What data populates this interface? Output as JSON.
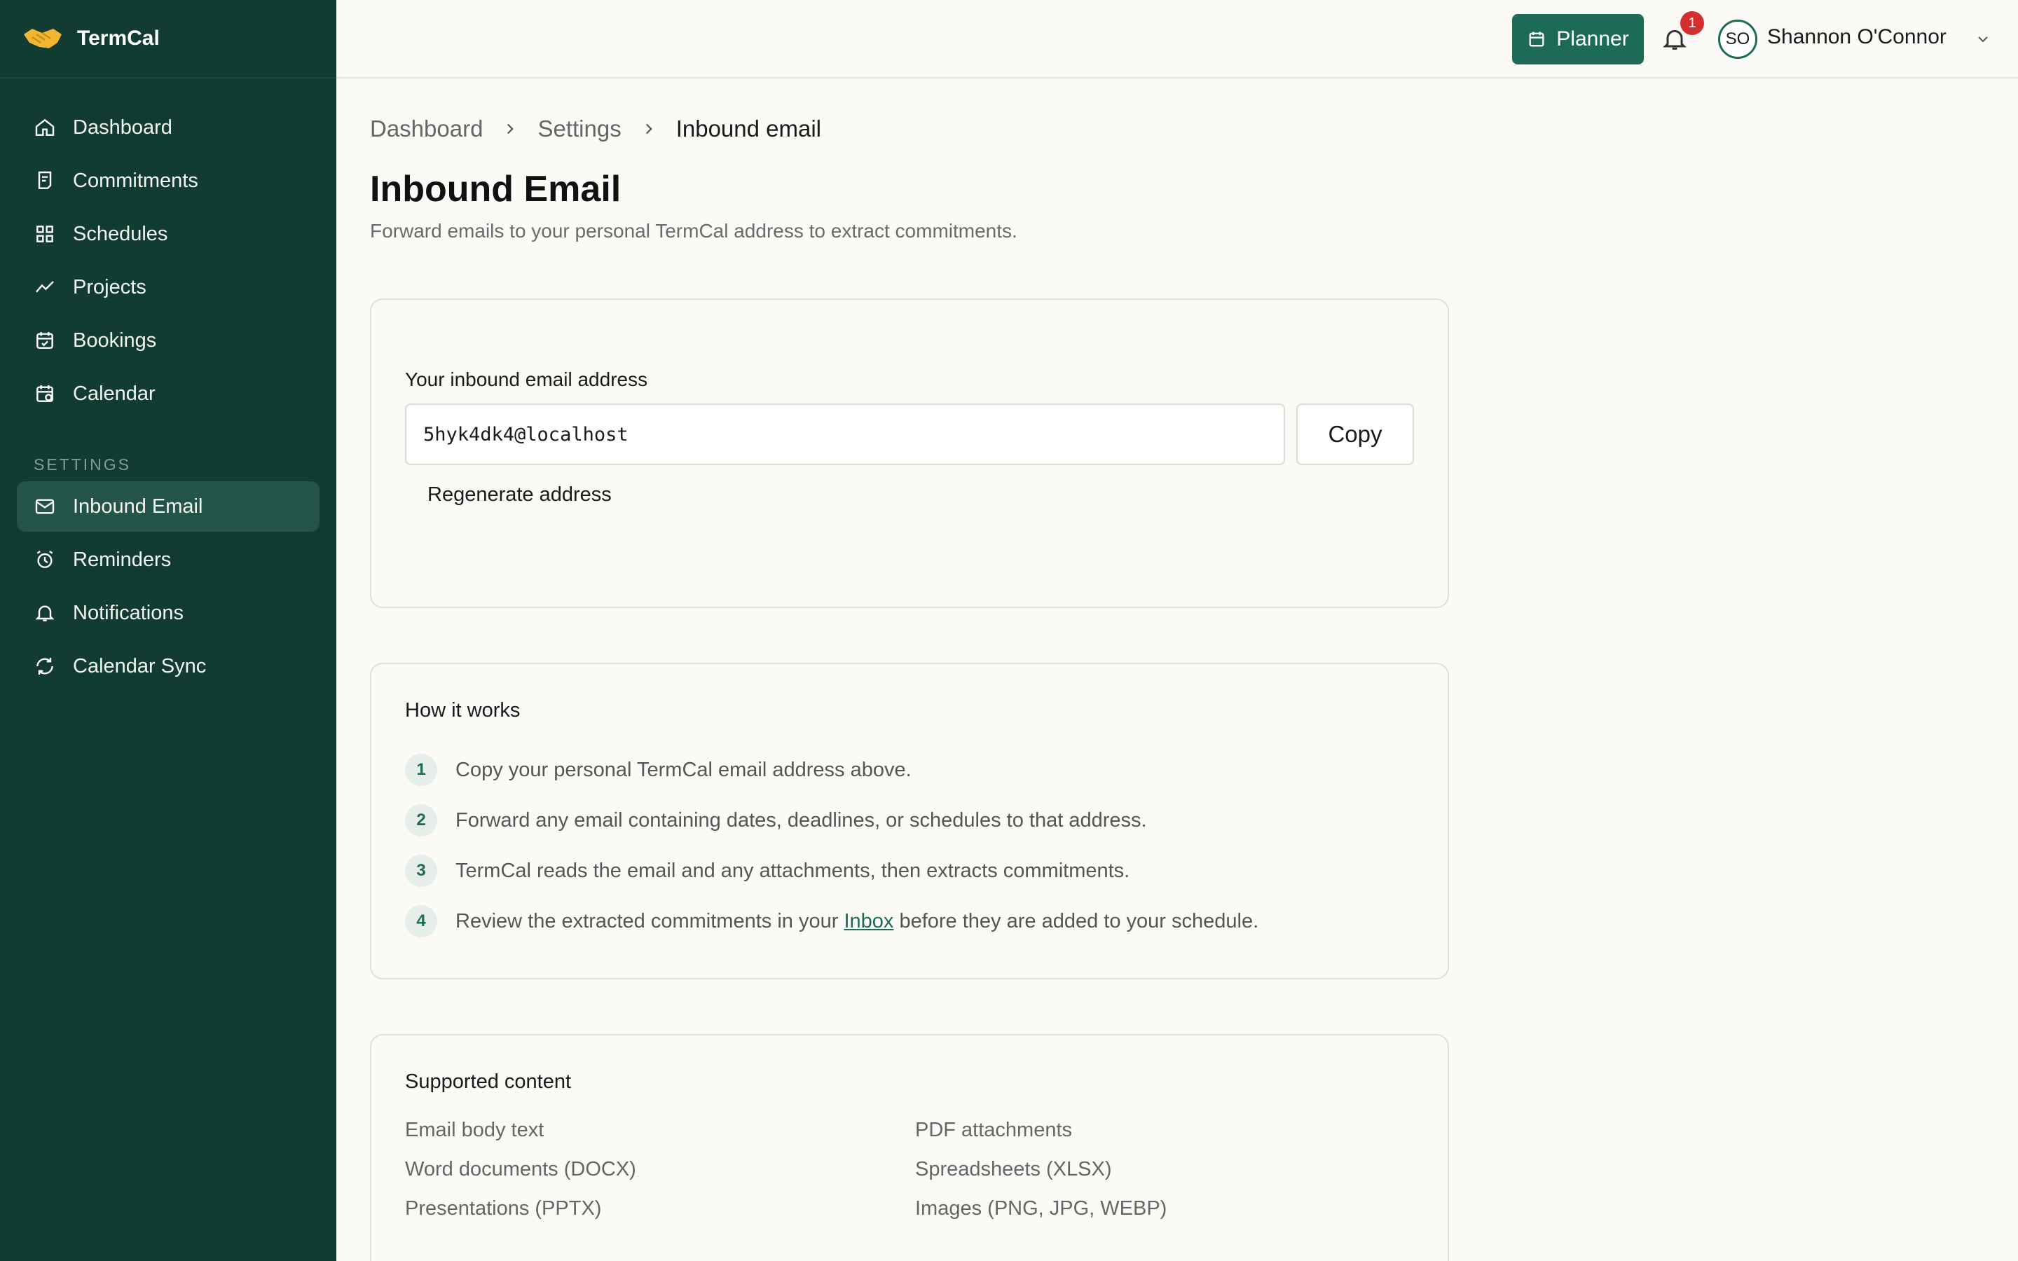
{
  "app": {
    "name": "TermCal"
  },
  "sidebar": {
    "items": [
      {
        "label": "Dashboard"
      },
      {
        "label": "Commitments"
      },
      {
        "label": "Schedules"
      },
      {
        "label": "Projects"
      },
      {
        "label": "Bookings"
      },
      {
        "label": "Calendar"
      }
    ],
    "section_label": "SETTINGS",
    "settings_items": [
      {
        "label": "Inbound Email",
        "active": true
      },
      {
        "label": "Reminders"
      },
      {
        "label": "Notifications"
      },
      {
        "label": "Calendar Sync"
      }
    ]
  },
  "topbar": {
    "planner_label": "Planner",
    "notification_count": "1",
    "user_initials": "SO",
    "user_name": "Shannon O'Connor"
  },
  "breadcrumb": [
    "Dashboard",
    "Settings",
    "Inbound email"
  ],
  "page": {
    "title": "Inbound Email",
    "subtitle": "Forward emails to your personal TermCal address to extract commitments."
  },
  "address_card": {
    "label": "Your inbound email address",
    "email": "5hyk4dk4@localhost",
    "copy_label": "Copy",
    "regenerate_label": "Regenerate address"
  },
  "how_it_works": {
    "title": "How it works",
    "steps": [
      {
        "num": "1",
        "text": "Copy your personal TermCal email address above."
      },
      {
        "num": "2",
        "text": "Forward any email containing dates, deadlines, or schedules to that address."
      },
      {
        "num": "3",
        "text": "TermCal reads the email and any attachments, then extracts commitments."
      },
      {
        "num": "4",
        "text_before": "Review the extracted commitments in your ",
        "link": "Inbox",
        "text_after": " before they are added to your schedule."
      }
    ]
  },
  "supported": {
    "title": "Supported content",
    "items": [
      "Email body text",
      "PDF attachments",
      "Word documents (DOCX)",
      "Spreadsheets (XLSX)",
      "Presentations (PPTX)",
      "Images (PNG, JPG, WEBP)"
    ]
  },
  "colors": {
    "sidebar_bg": "#123c32",
    "accent": "#1d6b57",
    "badge": "#d32f2f"
  }
}
